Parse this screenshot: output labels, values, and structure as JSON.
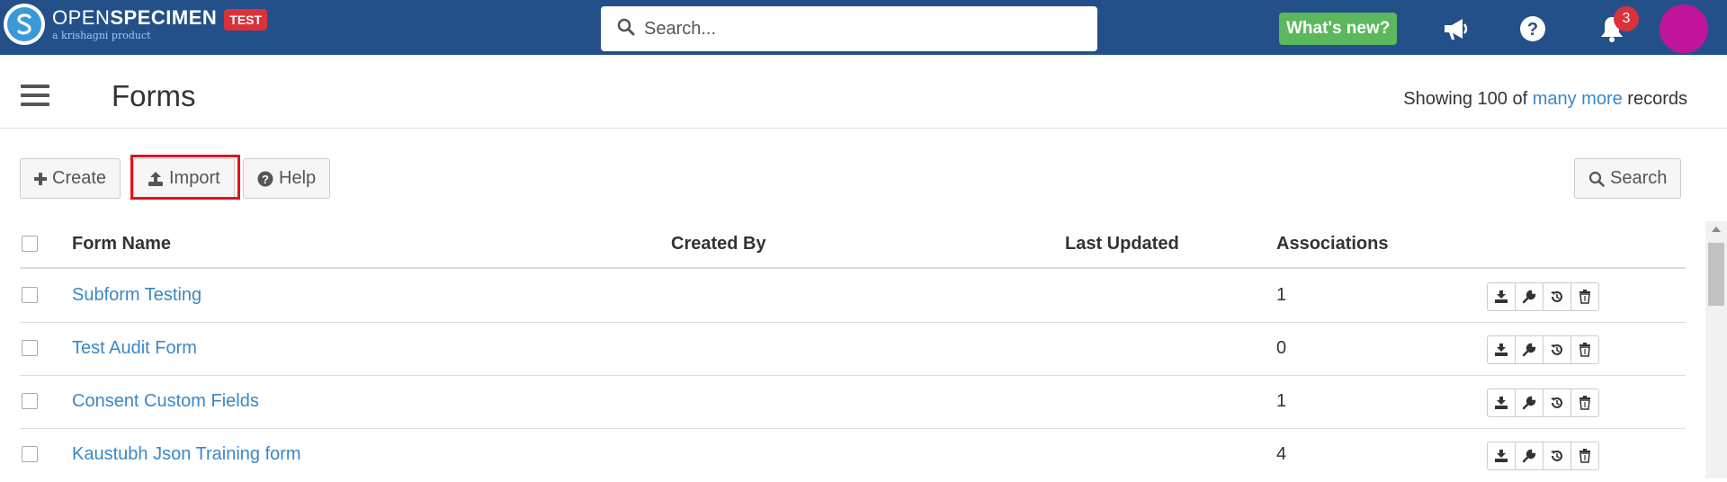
{
  "header": {
    "brand_light": "OPEN",
    "brand_bold": "SPECIMEN",
    "brand_sub": "a krishagni product",
    "env_badge": "TEST",
    "search_placeholder": "Search...",
    "whats_new": "What's new?",
    "notification_count": "3"
  },
  "page": {
    "title": "Forms",
    "records_prefix": "Showing 100 of",
    "records_link": "many more",
    "records_suffix": "records"
  },
  "toolbar": {
    "create": "Create",
    "import": "Import",
    "help": "Help",
    "search": "Search"
  },
  "table": {
    "columns": [
      "Form Name",
      "Created By",
      "Last Updated",
      "Associations"
    ],
    "rows": [
      {
        "name": "Subform Testing",
        "created_by": "",
        "last_updated": "",
        "associations": "1"
      },
      {
        "name": "Test Audit Form",
        "created_by": "",
        "last_updated": "",
        "associations": "0"
      },
      {
        "name": "Consent Custom Fields",
        "created_by": "",
        "last_updated": "",
        "associations": "1"
      },
      {
        "name": "Kaustubh Json Training form",
        "created_by": "",
        "last_updated": "",
        "associations": "4"
      }
    ]
  },
  "icons": {
    "logo": "openspecimen-logo-icon",
    "search": "search-icon",
    "announcements": "megaphone-icon",
    "help": "question-circle-icon",
    "notifications": "bell-icon",
    "menu": "hamburger-icon",
    "create": "plus-icon",
    "import": "upload-icon",
    "help_btn": "question-circle-icon",
    "row_actions": [
      "download-icon",
      "wrench-icon",
      "history-icon",
      "trash-icon"
    ]
  },
  "colors": {
    "topbar": "#24508a",
    "link": "#3a87c8",
    "whats_new": "#5cb85c",
    "badge": "#d9323a",
    "avatar": "#c0149a",
    "highlight": "#e0141e"
  }
}
